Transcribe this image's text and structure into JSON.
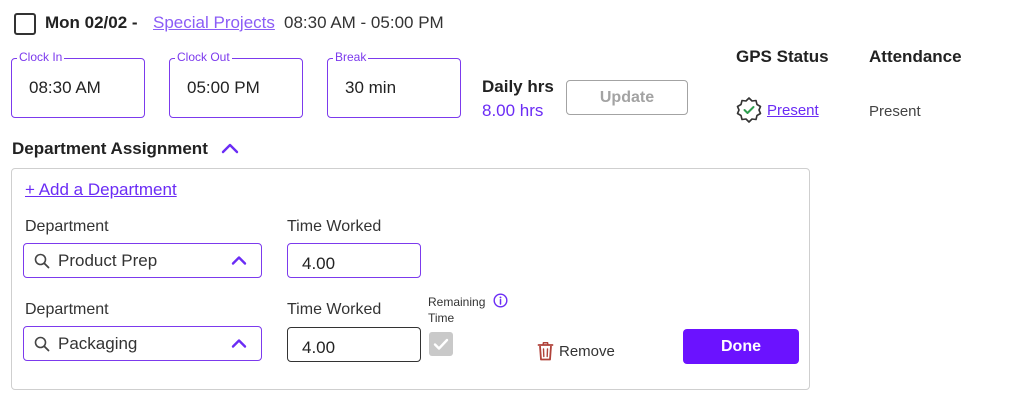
{
  "header": {
    "date": "Mon 02/02 -",
    "project_link": "Special Projects",
    "time_range": "08:30 AM - 05:00 PM"
  },
  "times": {
    "clock_in": {
      "label": "Clock In",
      "value": "08:30 AM"
    },
    "clock_out": {
      "label": "Clock Out",
      "value": "05:00 PM"
    },
    "break": {
      "label": "Break",
      "value": "30 min"
    }
  },
  "daily": {
    "label": "Daily hrs",
    "value": "8.00 hrs"
  },
  "update_button": "Update",
  "status": {
    "gps_header": "GPS Status",
    "gps_value": "Present",
    "attendance_header": "Attendance",
    "attendance_value": "Present"
  },
  "department_section": {
    "title": "Department Assignment",
    "add_link": "+ Add a Department",
    "rows": [
      {
        "dept_label": "Department",
        "dept_value": "Product Prep",
        "time_label": "Time Worked",
        "time_value": "4.00"
      },
      {
        "dept_label": "Department",
        "dept_value": "Packaging",
        "time_label": "Time Worked",
        "time_value": "4.00"
      }
    ],
    "remaining_label": "Remaining\nTime",
    "remove_label": "Remove",
    "done_button": "Done"
  },
  "colors": {
    "accent": "#6b2cf5",
    "done_button": "#6b12ff"
  },
  "icons": [
    "checkbox-icon",
    "verified-badge-icon",
    "chevron-up-icon",
    "search-icon",
    "info-icon",
    "trash-icon",
    "checkmark-icon"
  ]
}
